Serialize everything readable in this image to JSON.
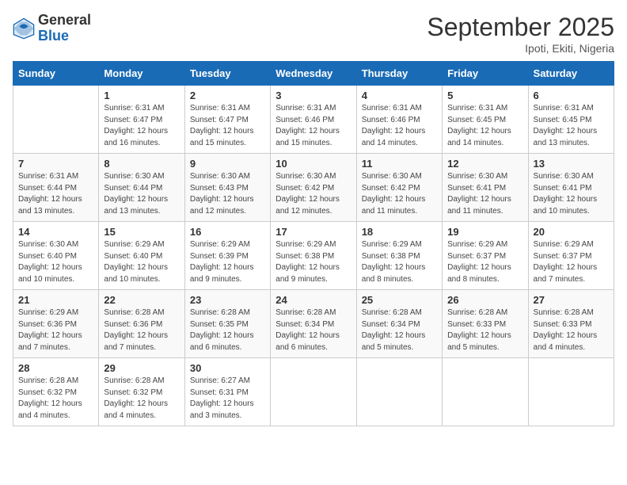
{
  "logo": {
    "general": "General",
    "blue": "Blue"
  },
  "title": "September 2025",
  "subtitle": "Ipoti, Ekiti, Nigeria",
  "days_header": [
    "Sunday",
    "Monday",
    "Tuesday",
    "Wednesday",
    "Thursday",
    "Friday",
    "Saturday"
  ],
  "weeks": [
    [
      {
        "num": "",
        "info": ""
      },
      {
        "num": "1",
        "info": "Sunrise: 6:31 AM\nSunset: 6:47 PM\nDaylight: 12 hours\nand 16 minutes."
      },
      {
        "num": "2",
        "info": "Sunrise: 6:31 AM\nSunset: 6:47 PM\nDaylight: 12 hours\nand 15 minutes."
      },
      {
        "num": "3",
        "info": "Sunrise: 6:31 AM\nSunset: 6:46 PM\nDaylight: 12 hours\nand 15 minutes."
      },
      {
        "num": "4",
        "info": "Sunrise: 6:31 AM\nSunset: 6:46 PM\nDaylight: 12 hours\nand 14 minutes."
      },
      {
        "num": "5",
        "info": "Sunrise: 6:31 AM\nSunset: 6:45 PM\nDaylight: 12 hours\nand 14 minutes."
      },
      {
        "num": "6",
        "info": "Sunrise: 6:31 AM\nSunset: 6:45 PM\nDaylight: 12 hours\nand 13 minutes."
      }
    ],
    [
      {
        "num": "7",
        "info": "Sunrise: 6:31 AM\nSunset: 6:44 PM\nDaylight: 12 hours\nand 13 minutes."
      },
      {
        "num": "8",
        "info": "Sunrise: 6:30 AM\nSunset: 6:44 PM\nDaylight: 12 hours\nand 13 minutes."
      },
      {
        "num": "9",
        "info": "Sunrise: 6:30 AM\nSunset: 6:43 PM\nDaylight: 12 hours\nand 12 minutes."
      },
      {
        "num": "10",
        "info": "Sunrise: 6:30 AM\nSunset: 6:42 PM\nDaylight: 12 hours\nand 12 minutes."
      },
      {
        "num": "11",
        "info": "Sunrise: 6:30 AM\nSunset: 6:42 PM\nDaylight: 12 hours\nand 11 minutes."
      },
      {
        "num": "12",
        "info": "Sunrise: 6:30 AM\nSunset: 6:41 PM\nDaylight: 12 hours\nand 11 minutes."
      },
      {
        "num": "13",
        "info": "Sunrise: 6:30 AM\nSunset: 6:41 PM\nDaylight: 12 hours\nand 10 minutes."
      }
    ],
    [
      {
        "num": "14",
        "info": "Sunrise: 6:30 AM\nSunset: 6:40 PM\nDaylight: 12 hours\nand 10 minutes."
      },
      {
        "num": "15",
        "info": "Sunrise: 6:29 AM\nSunset: 6:40 PM\nDaylight: 12 hours\nand 10 minutes."
      },
      {
        "num": "16",
        "info": "Sunrise: 6:29 AM\nSunset: 6:39 PM\nDaylight: 12 hours\nand 9 minutes."
      },
      {
        "num": "17",
        "info": "Sunrise: 6:29 AM\nSunset: 6:38 PM\nDaylight: 12 hours\nand 9 minutes."
      },
      {
        "num": "18",
        "info": "Sunrise: 6:29 AM\nSunset: 6:38 PM\nDaylight: 12 hours\nand 8 minutes."
      },
      {
        "num": "19",
        "info": "Sunrise: 6:29 AM\nSunset: 6:37 PM\nDaylight: 12 hours\nand 8 minutes."
      },
      {
        "num": "20",
        "info": "Sunrise: 6:29 AM\nSunset: 6:37 PM\nDaylight: 12 hours\nand 7 minutes."
      }
    ],
    [
      {
        "num": "21",
        "info": "Sunrise: 6:29 AM\nSunset: 6:36 PM\nDaylight: 12 hours\nand 7 minutes."
      },
      {
        "num": "22",
        "info": "Sunrise: 6:28 AM\nSunset: 6:36 PM\nDaylight: 12 hours\nand 7 minutes."
      },
      {
        "num": "23",
        "info": "Sunrise: 6:28 AM\nSunset: 6:35 PM\nDaylight: 12 hours\nand 6 minutes."
      },
      {
        "num": "24",
        "info": "Sunrise: 6:28 AM\nSunset: 6:34 PM\nDaylight: 12 hours\nand 6 minutes."
      },
      {
        "num": "25",
        "info": "Sunrise: 6:28 AM\nSunset: 6:34 PM\nDaylight: 12 hours\nand 5 minutes."
      },
      {
        "num": "26",
        "info": "Sunrise: 6:28 AM\nSunset: 6:33 PM\nDaylight: 12 hours\nand 5 minutes."
      },
      {
        "num": "27",
        "info": "Sunrise: 6:28 AM\nSunset: 6:33 PM\nDaylight: 12 hours\nand 4 minutes."
      }
    ],
    [
      {
        "num": "28",
        "info": "Sunrise: 6:28 AM\nSunset: 6:32 PM\nDaylight: 12 hours\nand 4 minutes."
      },
      {
        "num": "29",
        "info": "Sunrise: 6:28 AM\nSunset: 6:32 PM\nDaylight: 12 hours\nand 4 minutes."
      },
      {
        "num": "30",
        "info": "Sunrise: 6:27 AM\nSunset: 6:31 PM\nDaylight: 12 hours\nand 3 minutes."
      },
      {
        "num": "",
        "info": ""
      },
      {
        "num": "",
        "info": ""
      },
      {
        "num": "",
        "info": ""
      },
      {
        "num": "",
        "info": ""
      }
    ]
  ]
}
